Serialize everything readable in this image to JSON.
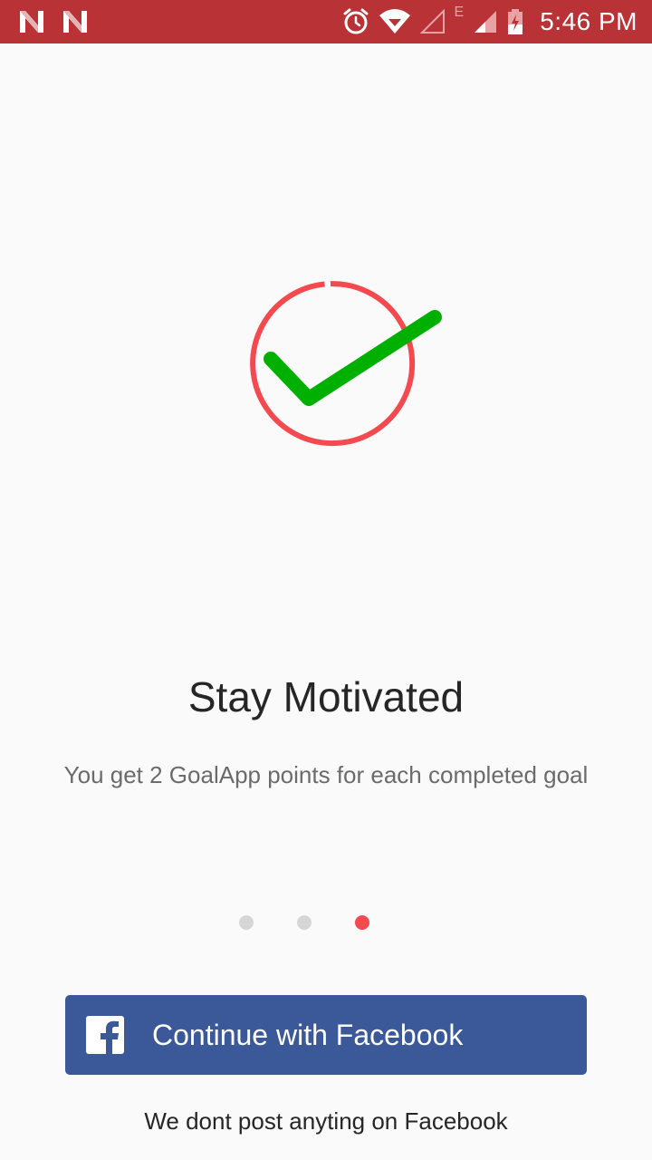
{
  "status_bar": {
    "time": "5:46 PM",
    "network_type": "E",
    "icons": [
      "n-notification-icon",
      "n-notification-icon",
      "alarm-icon",
      "wifi-icon",
      "cell-signal-icon",
      "cell-signal-icon",
      "battery-charging-icon"
    ],
    "background_color": "#b93236"
  },
  "onboarding": {
    "title": "Stay Motivated",
    "subtitle": "You get 2 GoalApp points for each completed goal",
    "hero_icon": "checkmark-circle-icon",
    "page_indicator": {
      "total_pages": 3,
      "current_page": 3,
      "active_color": "#f44a4f",
      "inactive_color": "#d6d6d6"
    }
  },
  "login": {
    "facebook_button_label": "Continue with Facebook",
    "facebook_icon": "facebook-icon",
    "facebook_color": "#3b5998",
    "disclaimer": "We dont post anyting on Facebook"
  },
  "colors": {
    "accent_red": "#f44a4f",
    "check_green": "#00b000",
    "background": "#fafafa"
  }
}
